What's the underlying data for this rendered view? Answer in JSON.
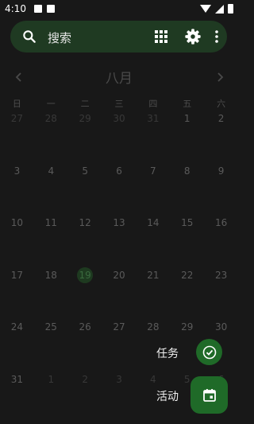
{
  "status_bar": {
    "time": "4:10"
  },
  "search": {
    "placeholder": "搜索"
  },
  "calendar": {
    "month_title": "八月",
    "weekdays": [
      "日",
      "一",
      "二",
      "三",
      "四",
      "五",
      "六"
    ],
    "weeks": [
      [
        "27",
        "28",
        "29",
        "30",
        "31",
        "1",
        "2"
      ],
      [
        "3",
        "4",
        "5",
        "6",
        "7",
        "8",
        "9"
      ],
      [
        "10",
        "11",
        "12",
        "13",
        "14",
        "15",
        "16"
      ],
      [
        "17",
        "18",
        "19",
        "20",
        "21",
        "22",
        "23"
      ],
      [
        "24",
        "25",
        "26",
        "27",
        "28",
        "29",
        "30"
      ],
      [
        "31",
        "1",
        "2",
        "3",
        "4",
        "5",
        "6"
      ]
    ],
    "today": "19"
  },
  "fab": {
    "task_label": "任务",
    "event_label": "活动"
  },
  "colors": {
    "accent": "#1f6a28",
    "search_bg": "#1f3a22",
    "background": "#181818"
  }
}
